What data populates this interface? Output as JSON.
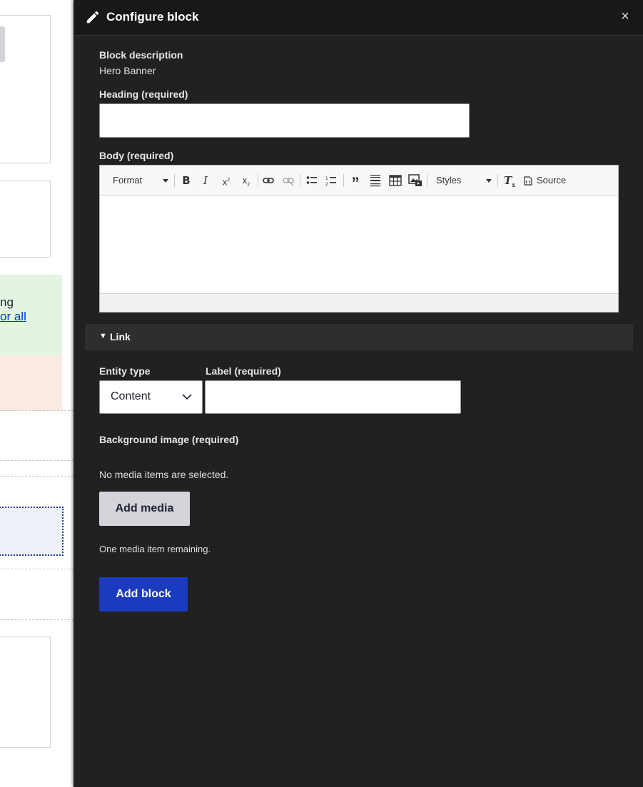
{
  "background_page": {
    "green_message_line1": "ng",
    "green_message_link": "or all"
  },
  "dialog": {
    "title": "Configure block",
    "close_label": "×",
    "block_description_label": "Block description",
    "block_description_value": "Hero Banner",
    "heading_label": "Heading (required)",
    "heading_value": "",
    "body_label": "Body (required)",
    "editor": {
      "format_label": "Format",
      "styles_label": "Styles",
      "source_label": "Source",
      "toolbar_icons": [
        "bold-icon",
        "italic-icon",
        "superscript-icon",
        "subscript-icon",
        "link-icon",
        "unlink-icon",
        "bulleted-list-icon",
        "numbered-list-icon",
        "blockquote-icon",
        "horizontal-line-icon",
        "table-icon",
        "image-icon",
        "remove-format-icon",
        "source-icon"
      ]
    },
    "link_section": {
      "summary_label": "Link",
      "entity_type_label": "Entity type",
      "entity_type_value": "Content",
      "label_field_label": "Label (required)",
      "label_field_value": ""
    },
    "background_image_label": "Background image (required)",
    "no_media_text": "No media items are selected.",
    "add_media_label": "Add media",
    "remaining_text": "One media item remaining.",
    "add_block_label": "Add block"
  },
  "colors": {
    "dialog_bg": "#212121",
    "titlebar_bg": "#181818",
    "primary_button": "#1b3bbf",
    "secondary_button": "#d3d4d9",
    "link_summary_bg": "#2e2e2e"
  }
}
